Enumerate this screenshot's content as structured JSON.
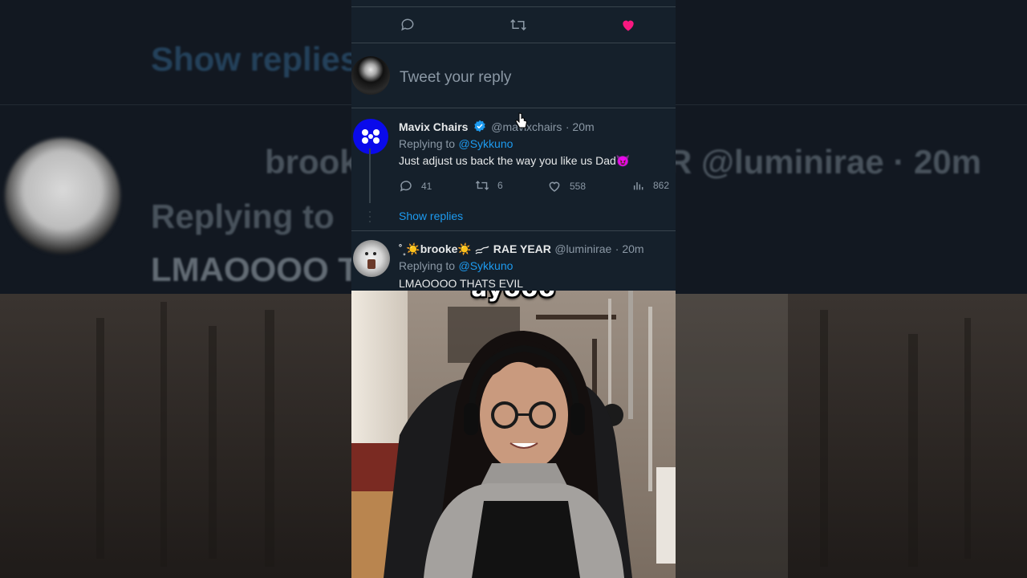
{
  "composer": {
    "placeholder": "Tweet your reply"
  },
  "tweet1": {
    "name": "Mavix Chairs",
    "handle": "@mavixchairs",
    "time": "· 20m",
    "replying_prefix": "Replying to",
    "replying_to": "@Sykkuno",
    "text": "Just adjust us back the way you like us Dad",
    "text_emoji": "😈",
    "stats": {
      "replies": "41",
      "retweets": "6",
      "likes": "558",
      "views": "862"
    },
    "show_replies": "Show replies"
  },
  "tweet2": {
    "name_prefix": "˚˳☀️brooke☀️",
    "name_suffix": "RAE YEAR",
    "handle": "@luminirae",
    "time": "· 20m",
    "replying_prefix": "Replying to",
    "replying_to": "@Sykkuno",
    "text": "LMAOOOO THATS EVIL"
  },
  "caption": "ayooo",
  "background": {
    "left_text_1": "Show replies",
    "left_text_2": "brook",
    "left_text_3": "Replying to",
    "left_text_4": "LMAOOOO T",
    "right_text_1": "R @luminirae · 20m"
  },
  "colors": {
    "link": "#1d9bf0",
    "like_active": "#f91880",
    "verified": "#1d9bf0"
  },
  "icons": [
    "reply-icon",
    "retweet-icon",
    "heart-icon",
    "verified-icon",
    "views-icon",
    "cursor-icon"
  ]
}
